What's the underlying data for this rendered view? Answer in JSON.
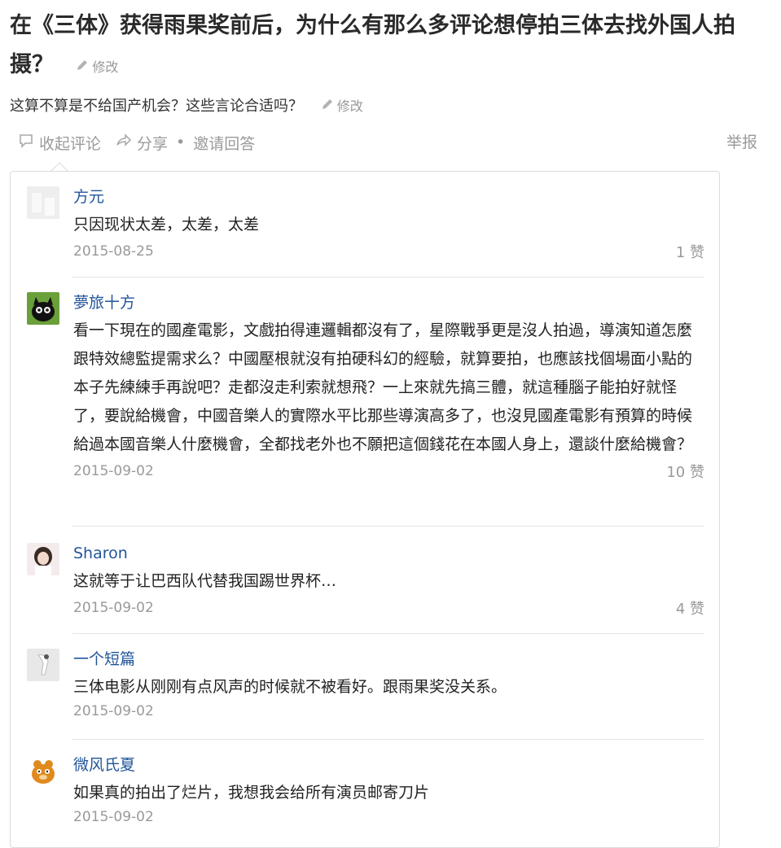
{
  "question": {
    "title": "在《三体》获得雨果奖前后，为什么有那么多评论想停拍三体去找外国人拍摄？",
    "title_edit": "修改",
    "detail": "这算不算是不给国产机会？这些言论合适吗？",
    "detail_edit": "修改"
  },
  "meta": {
    "collapse_comments": "收起评论",
    "share": "分享",
    "separator": "•",
    "invite": "邀请回答",
    "report": "举报"
  },
  "comments": [
    {
      "author": "方元",
      "text": "只因现状太差，太差，太差",
      "date": "2015-08-25",
      "likes": "1 赞"
    },
    {
      "author": "夢旅十方",
      "text": "看一下現在的國產電影，文戲拍得連邏輯都沒有了，星際戰爭更是沒人拍過，導演知道怎麼跟特效總監提需求么？中國壓根就沒有拍硬科幻的經驗，就算要拍，也應該找個場面小點的本子先練練手再說吧？走都沒走利索就想飛？一上來就先搞三體，就這種腦子能拍好就怪了，要說給機會，中國音樂人的實際水平比那些導演高多了，也沒見國產電影有預算的時候給過本國音樂人什麼機會，全都找老外也不願把這個錢花在本國人身上，還談什麼給機會？",
      "date": "2015-09-02",
      "likes": "10 赞"
    },
    {
      "author": "Sharon",
      "text": "这就等于让巴西队代替我国踢世界杯…",
      "date": "2015-09-02",
      "likes": "4 赞"
    },
    {
      "author": "一个短篇",
      "text": "三体电影从刚刚有点风声的时候就不被看好。跟雨果奖没关系。",
      "date": "2015-09-02",
      "likes": ""
    },
    {
      "author": "微风氏夏",
      "text": "如果真的拍出了烂片，我想我会给所有演员邮寄刀片",
      "date": "2015-09-02",
      "likes": ""
    }
  ],
  "colors": {
    "author_link": "#225599",
    "muted": "#999999",
    "border": "#dcdcdc"
  }
}
